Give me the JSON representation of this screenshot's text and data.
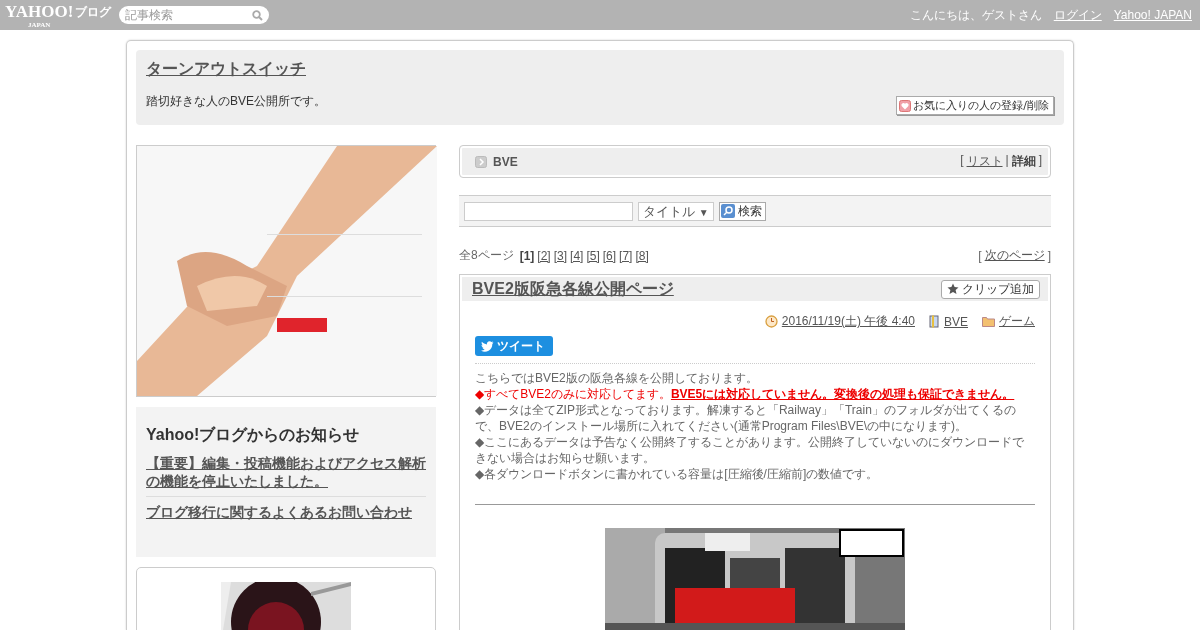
{
  "topbar": {
    "logo": {
      "wordmark": "YAHOO!",
      "sub": "JAPAN",
      "service": "ブログ"
    },
    "search": {
      "placeholder": "記事検索"
    },
    "greeting": "こんにちは、ゲストさん",
    "links": [
      "ログイン",
      "Yahoo! JAPAN"
    ]
  },
  "blog": {
    "title": "ターンアウトスイッチ",
    "description": "踏切好きな人のBVE公開所です。",
    "favorite_button": "お気に入りの人の登録/削除"
  },
  "sidebar": {
    "notice": {
      "heading": "Yahoo!ブログからのお知らせ",
      "links": [
        "【重要】編集・投稿機能およびアクセス解析の機能を停止いたしました。",
        "ブログ移行に関するよくあるお問い合わせ"
      ]
    }
  },
  "category": {
    "name": "BVE",
    "open": "[",
    "separator": "|",
    "close": "]",
    "views": [
      {
        "label": "リスト",
        "selected": false
      },
      {
        "label": "詳細",
        "selected": true
      }
    ]
  },
  "search": {
    "scope": "タイトル",
    "arrow": "▼",
    "button": "検索"
  },
  "pager": {
    "total": "全8ページ",
    "pages": [
      {
        "label": "[1]",
        "selected": true
      },
      {
        "label": "[2]",
        "selected": false
      },
      {
        "label": "[3]",
        "selected": false
      },
      {
        "label": "[4]",
        "selected": false
      },
      {
        "label": "[5]",
        "selected": false
      },
      {
        "label": "[6]",
        "selected": false
      },
      {
        "label": "[7]",
        "selected": false
      },
      {
        "label": "[8]",
        "selected": false
      }
    ],
    "open": "[",
    "next": "次のページ",
    "close": "]"
  },
  "article": {
    "title": "BVE2版阪急各線公開ページ",
    "clip_button": "クリップ追加",
    "date": "2016/11/19(土) 午後 4:40",
    "category": "BVE",
    "tag": "ゲーム",
    "tweet": "ツイート",
    "paragraphs": [
      {
        "kind": "normal",
        "text": "こちらではBVE2版の阪急各線を公開しております。"
      },
      {
        "kind": "warning",
        "text": "◆すべてBVE2のみに対応してます。**BVE5には対応していません。変換後の処理も保証できません。**"
      },
      {
        "kind": "normal",
        "text": "◆データは全てZIP形式となっております。解凍すると「Railway」「Train」のフォルダが出てくるので、BVE2のインストール場所に入れてください(通常Program Files\\BVE\\の中になります)。"
      },
      {
        "kind": "normal",
        "text": "◆ここにあるデータは予告なく公開終了することがあります。公開終了していないのにダウンロードできない場合はお知らせ願います。"
      },
      {
        "kind": "normal",
        "text": "◆各ダウンロードボタンに書かれている容量は[圧縮後/圧縮前]の数値です。"
      }
    ]
  }
}
